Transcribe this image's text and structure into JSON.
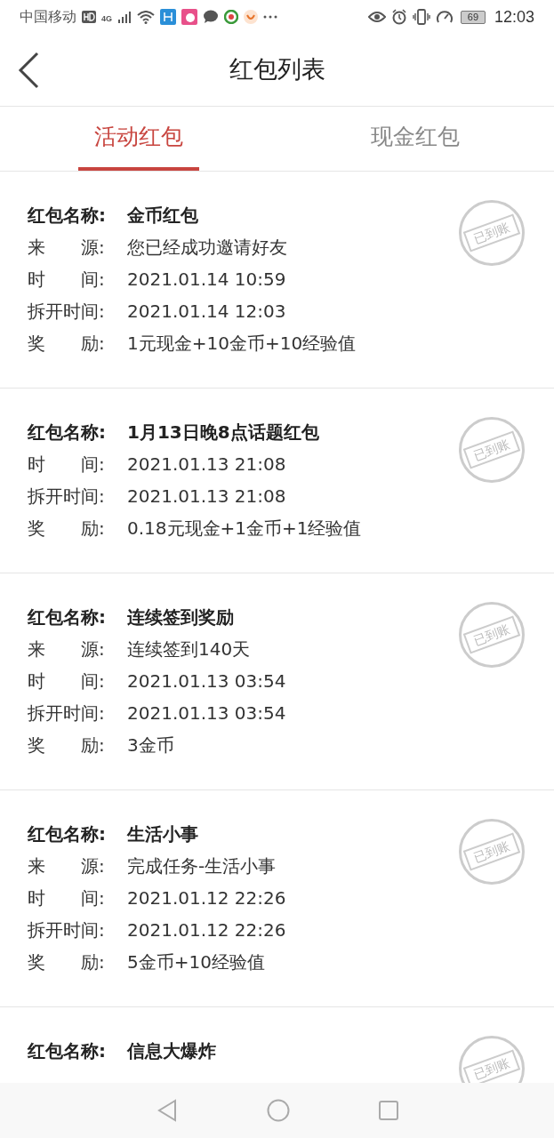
{
  "status_bar": {
    "carrier": "中国移动",
    "network": "4G",
    "time": "12:03",
    "battery": "69"
  },
  "header": {
    "title": "红包列表"
  },
  "tabs": [
    {
      "label": "活动红包",
      "selected": true
    },
    {
      "label": "现金红包",
      "selected": false
    }
  ],
  "cards": [
    {
      "stamp": "已到账",
      "rows": [
        {
          "label": "红包名称:",
          "value": "金币红包",
          "bold": true
        },
        {
          "label": "来　　源:",
          "value": "您已经成功邀请好友",
          "bold": false
        },
        {
          "label": "时　　间:",
          "value": "2021.01.14 10:59",
          "bold": false
        },
        {
          "label": "拆开时间:",
          "value": "2021.01.14 12:03",
          "bold": false
        },
        {
          "label": "奖　　励:",
          "value": "1元现金+10金币+10经验值",
          "bold": false
        }
      ]
    },
    {
      "stamp": "已到账",
      "rows": [
        {
          "label": "红包名称:",
          "value": "1月13日晚8点话题红包",
          "bold": true
        },
        {
          "label": "时　　间:",
          "value": "2021.01.13 21:08",
          "bold": false
        },
        {
          "label": "拆开时间:",
          "value": "2021.01.13 21:08",
          "bold": false
        },
        {
          "label": "奖　　励:",
          "value": "0.18元现金+1金币+1经验值",
          "bold": false
        }
      ]
    },
    {
      "stamp": "已到账",
      "rows": [
        {
          "label": "红包名称:",
          "value": "连续签到奖励",
          "bold": true
        },
        {
          "label": "来　　源:",
          "value": "连续签到140天",
          "bold": false
        },
        {
          "label": "时　　间:",
          "value": "2021.01.13 03:54",
          "bold": false
        },
        {
          "label": "拆开时间:",
          "value": "2021.01.13 03:54",
          "bold": false
        },
        {
          "label": "奖　　励:",
          "value": "3金币",
          "bold": false
        }
      ]
    },
    {
      "stamp": "已到账",
      "rows": [
        {
          "label": "红包名称:",
          "value": "生活小事",
          "bold": true
        },
        {
          "label": "来　　源:",
          "value": "完成任务-生活小事",
          "bold": false
        },
        {
          "label": "时　　间:",
          "value": "2021.01.12 22:26",
          "bold": false
        },
        {
          "label": "拆开时间:",
          "value": "2021.01.12 22:26",
          "bold": false
        },
        {
          "label": "奖　　励:",
          "value": "5金币+10经验值",
          "bold": false
        }
      ]
    },
    {
      "stamp": "已到账",
      "rows": [
        {
          "label": "红包名称:",
          "value": "信息大爆炸",
          "bold": true
        }
      ]
    }
  ]
}
